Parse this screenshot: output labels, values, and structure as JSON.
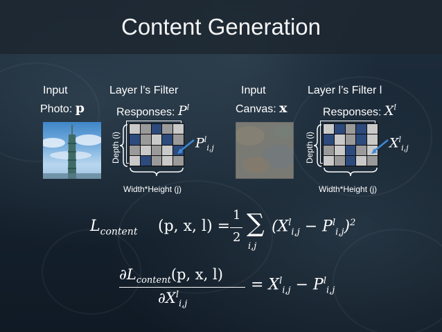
{
  "title": "Content Generation",
  "input_photo": {
    "line1": "Input",
    "line2": "Photo:",
    "symbol": "p"
  },
  "filter_p": {
    "line1": "Layer l’s Filter",
    "line2": "Responses:",
    "symbol": "P",
    "sup": "l",
    "cell_symbol": "P",
    "cell_sup": "l",
    "cell_sub": "i,j",
    "depth_label": "Depth (i)",
    "width_label": "Width*Height (j)"
  },
  "input_canvas": {
    "line1": "Input",
    "line2": "Canvas:",
    "symbol": "x"
  },
  "filter_x": {
    "line1": "Layer l’s Filter l",
    "line2": "Responses:",
    "symbol": "X",
    "sup": "l",
    "cell_symbol": "X",
    "cell_sup": "l",
    "cell_sub": "i,j",
    "depth_label": "Depth (i)",
    "width_label": "Width*Height (j)"
  },
  "eq1": {
    "lhs": "L",
    "lhs_sub": "content",
    "args": "(p, x, l) =",
    "frac_num": "1",
    "frac_den": "2",
    "sum": "∑",
    "sum_sub": "i,j",
    "body1": "(X",
    "body_sup": "l",
    "body_sub": "i,j",
    "minus": " − P",
    "body2_sup": "l",
    "body2_sub": "i,j",
    "close": ")",
    "power": "2"
  },
  "eq2": {
    "d": "∂L",
    "lhs_sub": "content",
    "args": "(p, x, l)",
    "den": "∂X",
    "den_sup": "l",
    "den_sub": "i,j",
    "rhs": "= X",
    "rhs_sup": "l",
    "rhs_sub": "i,j",
    "minus": " − P",
    "rhs2_sup": "l",
    "rhs2_sub": "i,j"
  },
  "colors": {
    "dark_blue": "#2c4a7c",
    "gray": "#9a9a9a",
    "light_gray": "#c8c8c8",
    "arrow": "#3d8ad8"
  }
}
